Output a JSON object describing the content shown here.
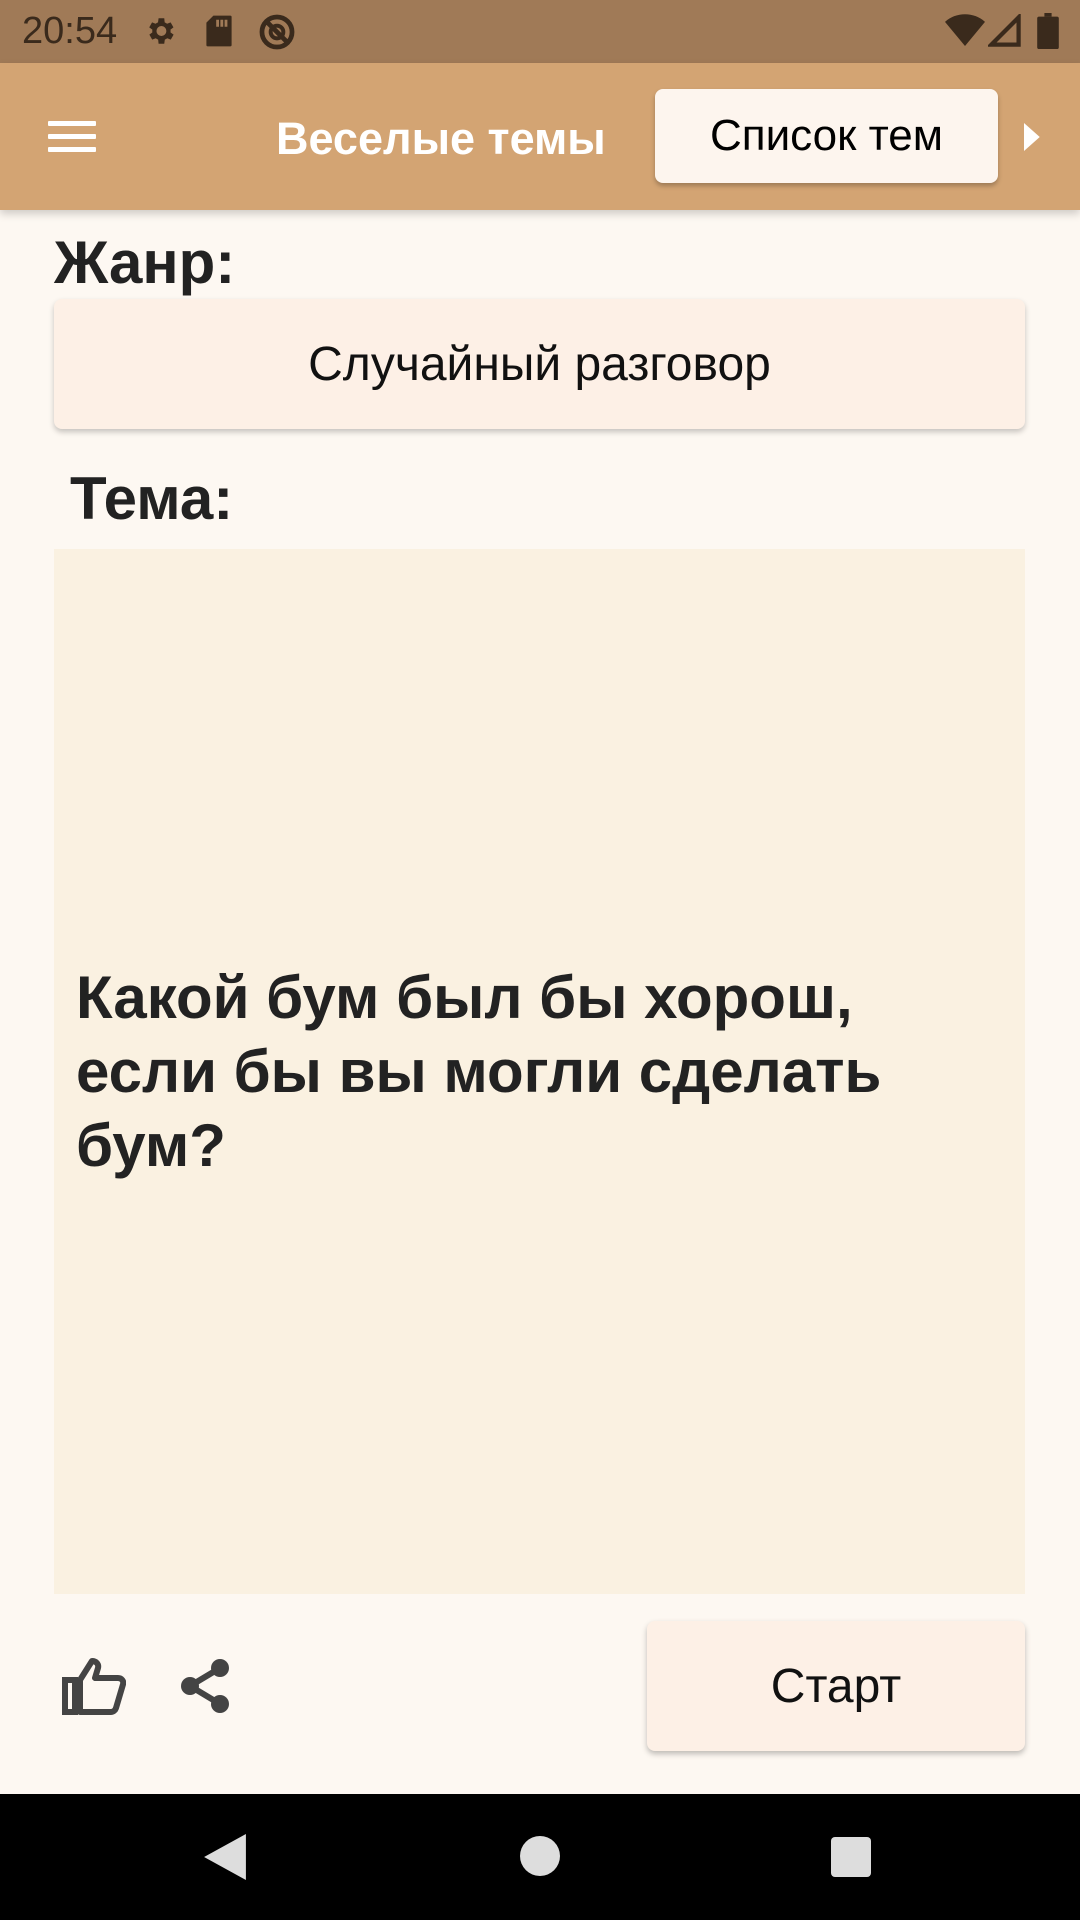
{
  "status_bar": {
    "time": "20:54",
    "icons": [
      "settings-icon",
      "sd-card-icon",
      "no-disturb-icon",
      "wifi-icon",
      "signal-icon",
      "battery-icon"
    ]
  },
  "app_bar": {
    "title": "Веселые темы",
    "topic_list_button": "Список тем",
    "icons": [
      "menu-icon",
      "chevron-right-icon"
    ]
  },
  "genre": {
    "label": "Жанр:",
    "value": "Случайный разговор"
  },
  "topic": {
    "label": "Тема:",
    "text": "Какой бум был бы хорош, если бы вы могли сделать бум?"
  },
  "actions": {
    "start_button": "Старт",
    "icons": [
      "thumbs-up-icon",
      "share-icon"
    ]
  },
  "nav_bar": {
    "icons": [
      "back-icon",
      "home-icon",
      "recents-icon"
    ]
  },
  "colors": {
    "status_bar": "#A07A57",
    "app_bar": "#D3A473",
    "background": "#FDF8F2",
    "button": "#FDF0E6",
    "topic_card": "#FAF1E1"
  }
}
